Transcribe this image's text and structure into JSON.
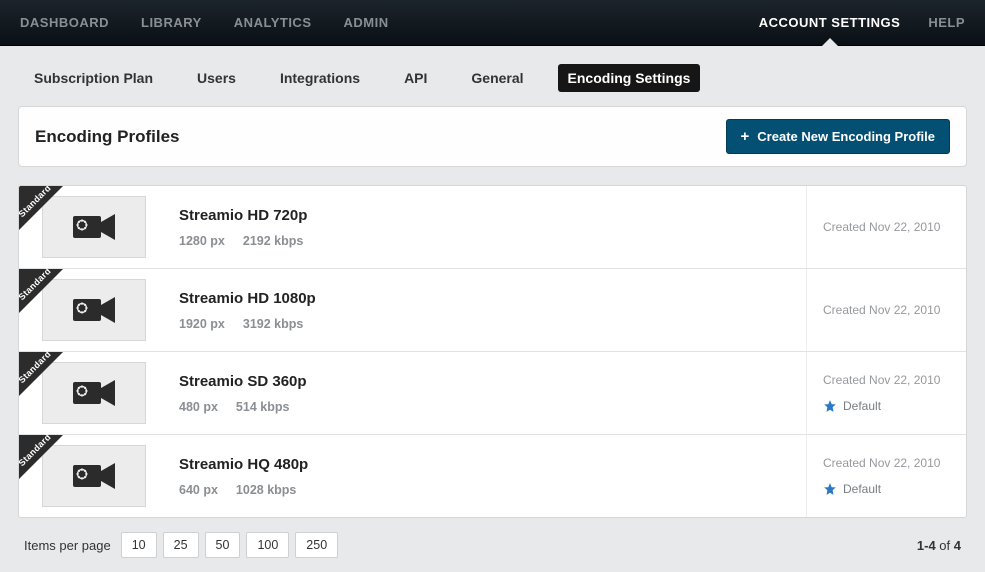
{
  "topnav": {
    "left": [
      "DASHBOARD",
      "LIBRARY",
      "ANALYTICS",
      "ADMIN"
    ],
    "right": [
      "ACCOUNT SETTINGS",
      "HELP"
    ],
    "active": "ACCOUNT SETTINGS"
  },
  "subnav": {
    "items": [
      "Subscription Plan",
      "Users",
      "Integrations",
      "API",
      "General",
      "Encoding Settings"
    ],
    "active": "Encoding Settings"
  },
  "section": {
    "title": "Encoding Profiles",
    "create_button": "Create New Encoding Profile"
  },
  "profiles": [
    {
      "ribbon": "Standard",
      "name": "Streamio HD 720p",
      "width": "1280 px",
      "bitrate": "2192 kbps",
      "created": "Created Nov 22, 2010",
      "default": false
    },
    {
      "ribbon": "Standard",
      "name": "Streamio HD 1080p",
      "width": "1920 px",
      "bitrate": "3192 kbps",
      "created": "Created Nov 22, 2010",
      "default": false
    },
    {
      "ribbon": "Standard",
      "name": "Streamio SD 360p",
      "width": "480 px",
      "bitrate": "514 kbps",
      "created": "Created Nov 22, 2010",
      "default": true,
      "default_label": "Default"
    },
    {
      "ribbon": "Standard",
      "name": "Streamio HQ 480p",
      "width": "640 px",
      "bitrate": "1028 kbps",
      "created": "Created Nov 22, 2010",
      "default": true,
      "default_label": "Default"
    }
  ],
  "pagination": {
    "label": "Items per page",
    "options": [
      "10",
      "25",
      "50",
      "100",
      "250"
    ],
    "range_bold": "1-4",
    "range_of": " of ",
    "range_total": "4"
  }
}
